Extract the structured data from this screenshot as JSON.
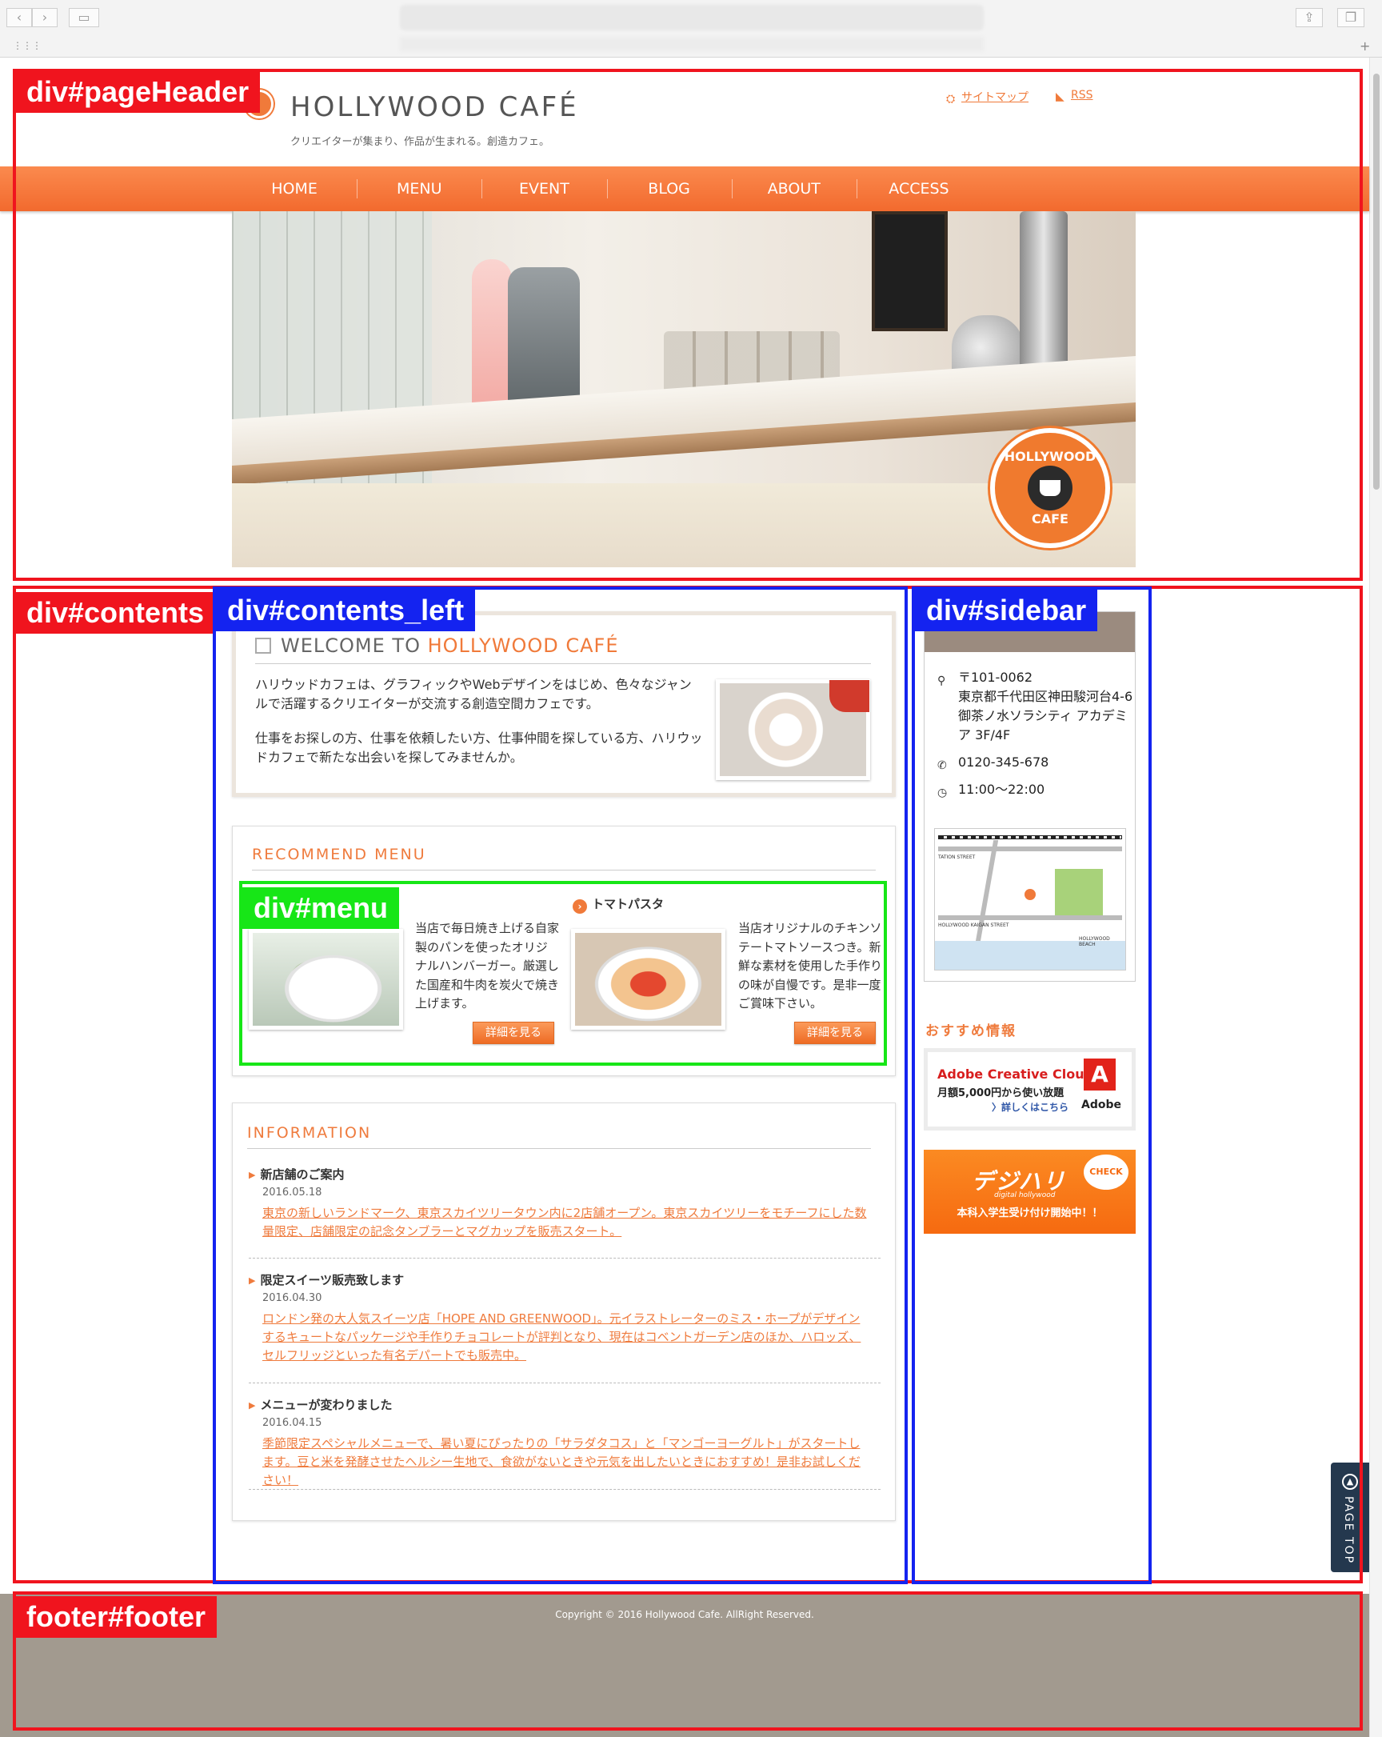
{
  "site": {
    "brand": "HOLLYWOOD CAFÉ",
    "tagline": "クリエイターが集まり、作品が生まれる。創造カフェ。",
    "util_links": [
      "サイトマップ",
      "RSS"
    ],
    "nav": [
      "HOME",
      "MENU",
      "EVENT",
      "BLOG",
      "ABOUT",
      "ACCESS"
    ],
    "hero_badge": [
      "HOLLYWOOD",
      "CAFE"
    ]
  },
  "annotations": {
    "pageHeader": "div#pageHeader",
    "contents": "div#contents",
    "contents_left": "div#contents_left",
    "sidebar": "div#sidebar",
    "menu": "div#menu",
    "footer": "footer#footer"
  },
  "welcome": {
    "title_prefix": "WELCOME TO ",
    "title_highlight": "HOLLYWOOD CAFÉ",
    "para1": "ハリウッドカフェは、グラフィックやWebデザインをはじめ、色々なジャンルで活躍するクリエイターが交流する創造空間カフェです。",
    "para2": "仕事をお探しの方、仕事を依頼したい方、仕事仲間を探している方、ハリウッドカフェで新たな出会いを探してみませんか。"
  },
  "recommend": {
    "title": "RECOMMEND MENU",
    "items": [
      {
        "name": "",
        "text": "当店で毎日焼き上げる自家製のパンを使ったオリジナルハンバーガー。厳選した国産和牛肉を炭火で焼き上げます。",
        "button": "詳細を見る"
      },
      {
        "name": "トマトパスタ",
        "text": "当店オリジナルのチキンソテートマトソースつき。新鮮な素材を使用した手作りの味が自慢です。是非一度ご賞味下さい。",
        "button": "詳細を見る"
      }
    ]
  },
  "information": {
    "title": "INFORMATION",
    "news": [
      {
        "title": "新店舗のご案内",
        "date": "2016.05.18",
        "body": "東京の新しいランドマーク、東京スカイツリータウン内に2店舗オープン。東京スカイツリーをモチーフにした数量限定、店舗限定の記念タンブラーとマグカップを販売スタート。"
      },
      {
        "title": "限定スイーツ販売致します",
        "date": "2016.04.30",
        "body": "ロンドン発の大人気スイーツ店「HOPE AND GREENWOOD」。元イラストレーターのミス・ホープがデザインするキュートなパッケージや手作りチョコレートが評判となり、現在はコベントガーデン店のほか、ハロッズ、セルフリッジといった有名デパートでも販売中。"
      },
      {
        "title": "メニューが変わりました",
        "date": "2016.04.15",
        "body": "季節限定スペシャルメニューで、暑い夏にぴったりの「サラダタコス」と「マンゴーヨーグルト」がスタートします。豆と米を発酵させたヘルシー生地で、食欲がないときや元気を出したいときにおすすめ！是非お試しください！"
      }
    ]
  },
  "sidebar": {
    "address": "〒101-0062\n東京都千代田区神田駿河台4-6\n御茶ノ水ソラシティ アカデミア 3F/4F",
    "tel": "0120-345-678",
    "hours": "11:00〜22:00",
    "map_labels": [
      "TATION STREET",
      "HOLLYWOOD KAIGAN STREET",
      "HOLLYWOOD BEACH"
    ],
    "recommend_title": "おすすめ情報",
    "adobe": {
      "title": "Adobe Creative Cloud",
      "line2": "月額5,000円から使い放題",
      "line3": "〉詳しくはこちら",
      "brand": "Adobe"
    },
    "deji": {
      "title": "デジハリ",
      "sub": "digital hollywood",
      "check": "CHECK",
      "bottom": "本科入学生受け付け開始中！！"
    }
  },
  "pagetop": "PAGE TOP",
  "footer": {
    "copyright": "Copyright © 2016 Hollywood Cafe. AllRight Reserved."
  },
  "colors": {
    "accent": "#f07a3a",
    "annot_red": "#f0141e",
    "annot_blue": "#1423f0",
    "annot_green": "#17e617",
    "footer": "#a29a8f"
  }
}
